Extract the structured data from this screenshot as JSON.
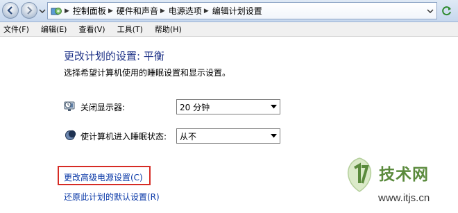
{
  "addressbar": {
    "breadcrumbs": [
      "控制面板",
      "硬件和声音",
      "电源选项",
      "编辑计划设置"
    ]
  },
  "menubar": {
    "items": [
      "文件(F)",
      "编辑(E)",
      "查看(V)",
      "工具(T)",
      "帮助(H)"
    ]
  },
  "main": {
    "title": "更改计划的设置: 平衡",
    "subtitle": "选择希望计算机使用的睡眠设置和显示设置。",
    "settings": [
      {
        "label": "关闭显示器:",
        "value": "20 分钟",
        "icon": "monitor-clock-icon"
      },
      {
        "label": "使计算机进入睡眠状态:",
        "value": "从不",
        "icon": "moon-icon"
      }
    ],
    "links": {
      "advanced": "更改高级电源设置(C)",
      "restore": "还原此计划的默认设置(R)"
    },
    "highlight_color": "#d62b24"
  },
  "watermark": {
    "brand": "技术网",
    "url": "www.itjs.cn"
  }
}
